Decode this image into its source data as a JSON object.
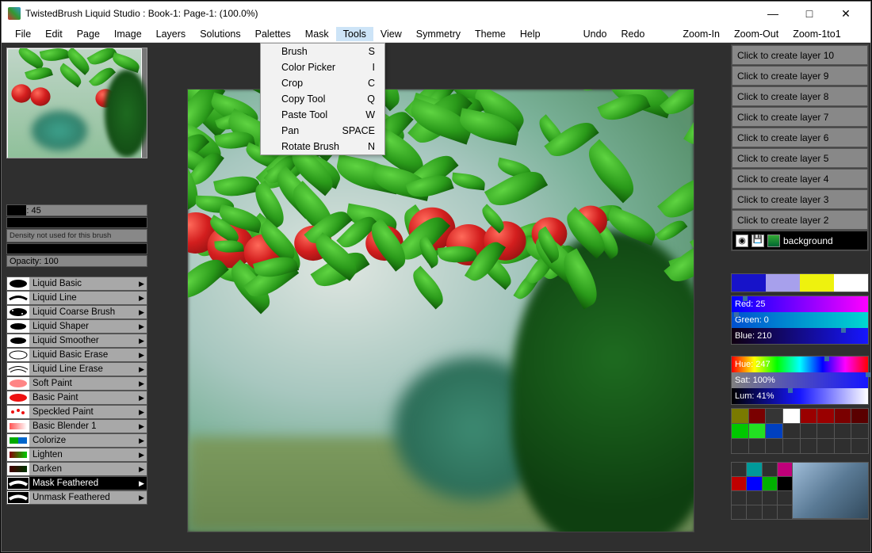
{
  "title": "TwistedBrush Liquid Studio : Book-1: Page-1:  (100.0%)",
  "window_controls": {
    "min": "—",
    "max": "□",
    "close": "✕"
  },
  "menubar": [
    "File",
    "Edit",
    "Page",
    "Image",
    "Layers",
    "Solutions",
    "Palettes",
    "Mask",
    "Tools",
    "View",
    "Symmetry",
    "Theme",
    "Help"
  ],
  "menubar_right": [
    "Undo",
    "Redo",
    "Zoom-In",
    "Zoom-Out",
    "Zoom-1to1"
  ],
  "active_menu": "Tools",
  "tools_menu": [
    {
      "label": "Brush",
      "shortcut": "S"
    },
    {
      "label": "Color Picker",
      "shortcut": "I"
    },
    {
      "label": "Crop",
      "shortcut": "C"
    },
    {
      "label": "Copy Tool",
      "shortcut": "Q"
    },
    {
      "label": "Paste Tool",
      "shortcut": "W"
    },
    {
      "label": "Pan",
      "shortcut": "SPACE"
    },
    {
      "label": "Rotate Brush",
      "shortcut": "N"
    }
  ],
  "left": {
    "size_label": "Size: 45",
    "density_note": "Density not used for this brush",
    "opacity_label": "Opacity: 100",
    "brushes": [
      {
        "name": "Liquid Basic",
        "sel": false
      },
      {
        "name": "Liquid Line",
        "sel": false
      },
      {
        "name": "Liquid Coarse Brush",
        "sel": false
      },
      {
        "name": "Liquid Shaper",
        "sel": false
      },
      {
        "name": "Liquid Smoother",
        "sel": false
      },
      {
        "name": "Liquid Basic Erase",
        "sel": false
      },
      {
        "name": "Liquid Line Erase",
        "sel": false
      },
      {
        "name": "Soft Paint",
        "sel": false
      },
      {
        "name": "Basic Paint",
        "sel": false
      },
      {
        "name": "Speckled Paint",
        "sel": false
      },
      {
        "name": "Basic Blender 1",
        "sel": false
      },
      {
        "name": "Colorize",
        "sel": false
      },
      {
        "name": "Lighten",
        "sel": false
      },
      {
        "name": "Darken",
        "sel": false
      },
      {
        "name": "Mask Feathered",
        "sel": true
      },
      {
        "name": "Unmask Feathered",
        "sel": false
      }
    ]
  },
  "right": {
    "layers": [
      "Click to create layer 10",
      "Click to create layer 9",
      "Click to create layer 8",
      "Click to create layer 7",
      "Click to create layer 6",
      "Click to create layer 5",
      "Click to create layer 4",
      "Click to create layer 3",
      "Click to create layer 2"
    ],
    "current_layer": "background",
    "swatches": [
      "#1713c9",
      "#a7a0ec",
      "#eef20e",
      "#ffffff"
    ],
    "rgb": [
      {
        "label": "Red: 25",
        "bg": "linear-gradient(90deg,#00f 0%,#f0f 100%)",
        "mark": "8%"
      },
      {
        "label": "Green: 0",
        "bg": "linear-gradient(90deg,#0050d0 0%,#00d8d0 100%)",
        "mark": "2%"
      },
      {
        "label": "Blue: 210",
        "bg": "linear-gradient(90deg,#100010 0%,#1616ff 100%)",
        "mark": "80%"
      }
    ],
    "hsl": [
      {
        "label": "Hue: 247",
        "bg": "linear-gradient(90deg,#f00,#ff0,#0f0,#0ff,#00f,#f0f,#f00)",
        "mark": "68%"
      },
      {
        "label": "Sat: 100%",
        "bg": "linear-gradient(90deg,#808080,#1616ff)",
        "mark": "98%"
      },
      {
        "label": "Lum: 41%",
        "bg": "linear-gradient(90deg,#000,#1616ff 50%,#fff)",
        "mark": "41%"
      }
    ],
    "palette": [
      "#7a7a00",
      "#7a0000",
      "#353535",
      "#ffffff",
      "#9a0000",
      "#9a0000",
      "#7a0000",
      "#5a0000",
      "#00c800",
      "#22e022",
      "#0040c0",
      "#2f2f2f",
      "#2f2f2f",
      "#2f2f2f",
      "#2f2f2f",
      "#2f2f2f",
      "#2f2f2f",
      "#2f2f2f",
      "#2f2f2f",
      "#2f2f2f",
      "#2f2f2f",
      "#2f2f2f",
      "#2f2f2f",
      "#2f2f2f"
    ],
    "mini_palette": [
      "#2f2f2f",
      "#009a9a",
      "#2f2f2f",
      "#c0007a",
      "#c00000",
      "#0000ff",
      "#00b000",
      "#000000",
      "#2f2f2f",
      "#2f2f2f",
      "#2f2f2f",
      "#2f2f2f",
      "#2f2f2f",
      "#2f2f2f",
      "#2f2f2f",
      "#2f2f2f"
    ]
  }
}
